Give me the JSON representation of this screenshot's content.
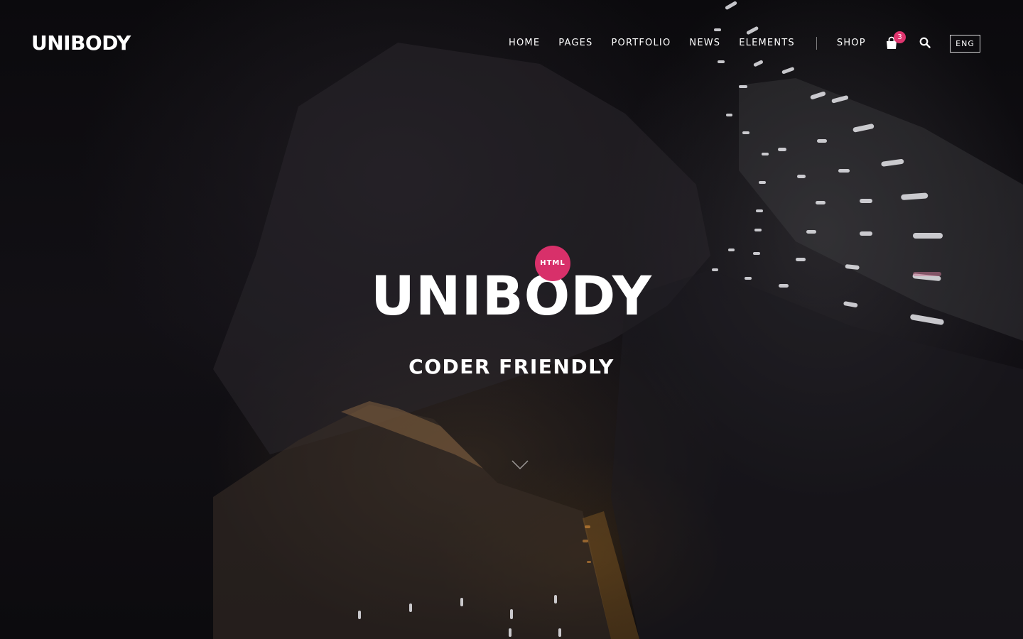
{
  "brand": {
    "logo_text": "UNIBODY"
  },
  "nav": {
    "items": [
      {
        "label": "HOME"
      },
      {
        "label": "PAGES"
      },
      {
        "label": "PORTFOLIO"
      },
      {
        "label": "NEWS"
      },
      {
        "label": "ELEMENTS"
      },
      {
        "label": "SHOP"
      }
    ],
    "cart_count": "3",
    "language": "ENG"
  },
  "hero": {
    "badge": "HTML",
    "title": "UNIBODY",
    "subtitle": "CODER FRIENDLY"
  },
  "icons": {
    "cart": "shopping-bag-icon",
    "search": "search-icon",
    "scroll": "chevron-down-icon"
  },
  "colors": {
    "accent": "#d8306a",
    "background": "#0d0b0e",
    "text": "#ffffff"
  }
}
